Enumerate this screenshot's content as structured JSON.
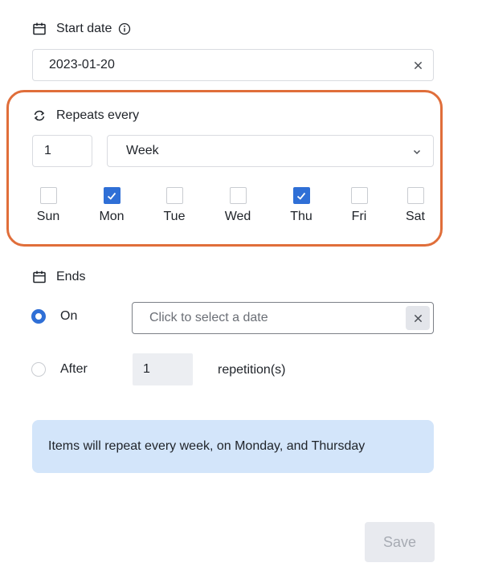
{
  "start_date": {
    "label": "Start date",
    "value": "2023-01-20"
  },
  "repeats": {
    "label": "Repeats every",
    "interval": "1",
    "unit": "Week",
    "days": [
      {
        "label": "Sun",
        "checked": false
      },
      {
        "label": "Mon",
        "checked": true
      },
      {
        "label": "Tue",
        "checked": false
      },
      {
        "label": "Wed",
        "checked": false
      },
      {
        "label": "Thu",
        "checked": true
      },
      {
        "label": "Fri",
        "checked": false
      },
      {
        "label": "Sat",
        "checked": false
      }
    ]
  },
  "ends": {
    "label": "Ends",
    "on_label": "On",
    "on_selected": true,
    "date_placeholder": "Click to select a date",
    "after_label": "After",
    "after_selected": false,
    "repetitions": "1",
    "repetitions_label": "repetition(s)"
  },
  "summary": "Items will repeat every week, on Monday, and Thursday",
  "save_label": "Save",
  "colors": {
    "accent": "#2f6fd6",
    "highlight": "#e06e3a",
    "summary_bg": "#d3e5fa"
  }
}
